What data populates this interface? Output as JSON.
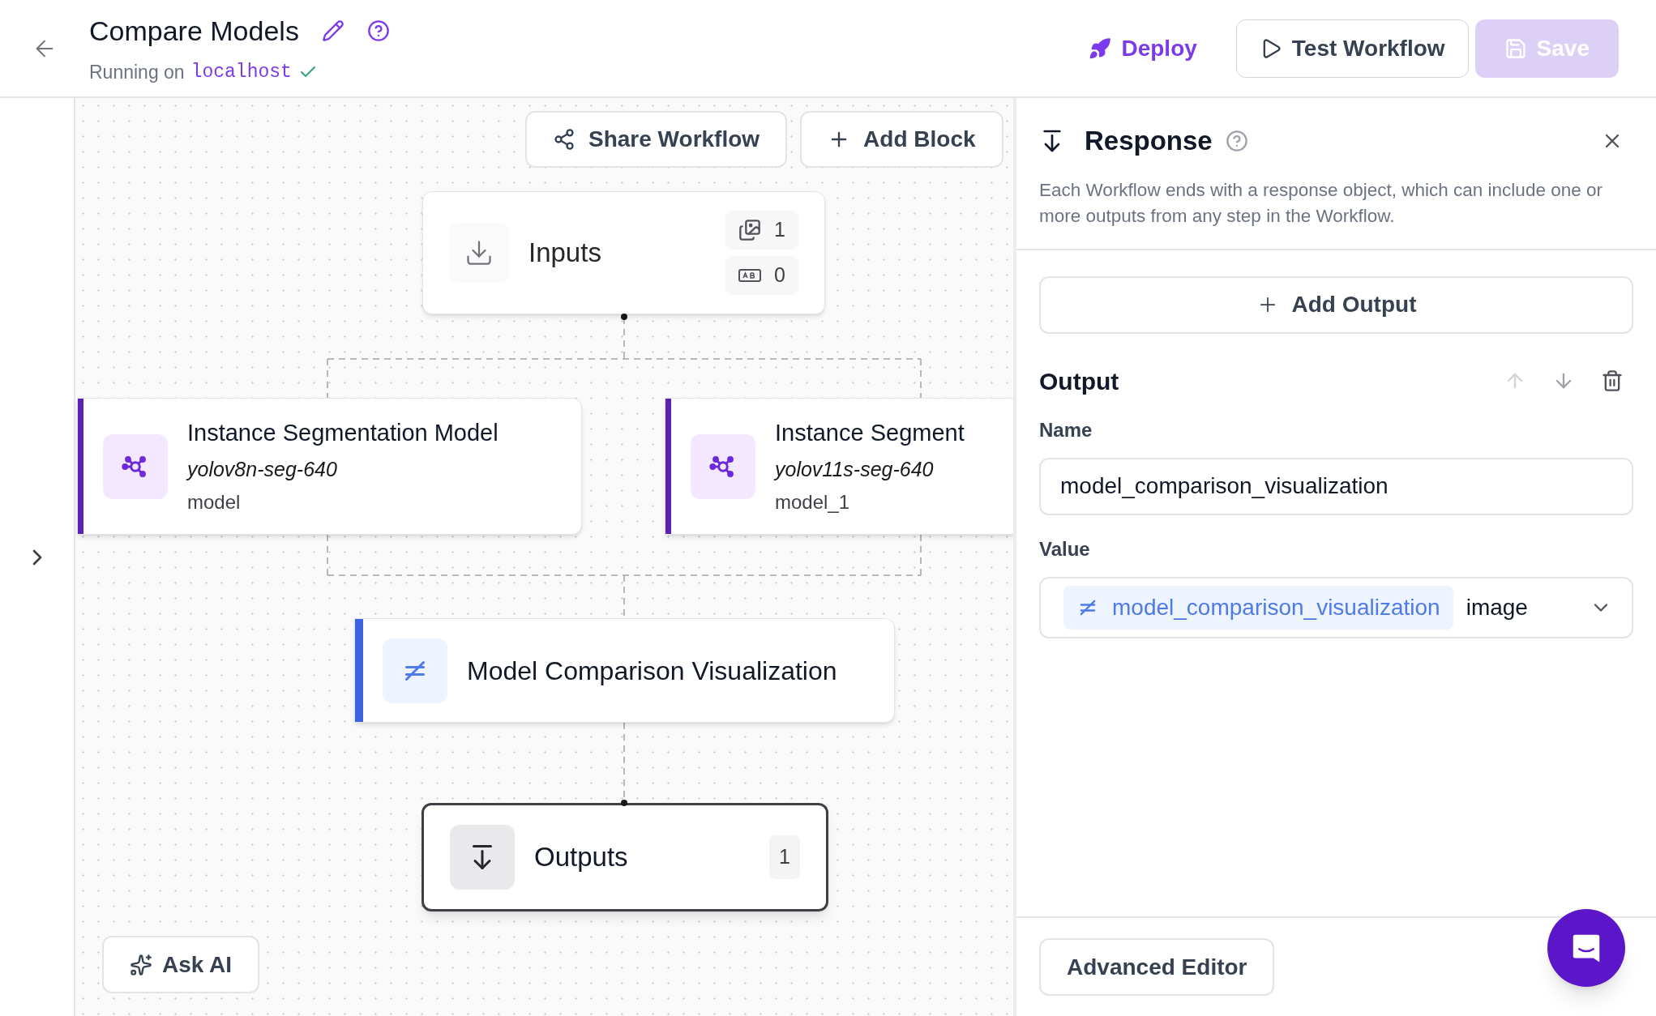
{
  "header": {
    "title": "Compare Models",
    "status_prefix": "Running on",
    "host": "localhost",
    "connected": true
  },
  "actions": [
    {
      "label": "Deploy",
      "kind": "link"
    },
    {
      "label": "Test Workflow",
      "kind": "outline"
    },
    {
      "label": "Save",
      "kind": "primary",
      "disabled": true
    }
  ],
  "canvas": {
    "toolbar": [
      {
        "label": "Share Workflow",
        "kind": "share"
      },
      {
        "label": "Add Block",
        "kind": "add"
      }
    ],
    "inputs": {
      "title": "Inputs",
      "counts": [
        {
          "kind": "image",
          "value": "1"
        },
        {
          "kind": "text",
          "value": "0"
        }
      ]
    },
    "nodes": [
      {
        "kind": "model",
        "title": "Instance Segmentation Model",
        "model_id": "yolov8n-seg-640",
        "name": "model"
      },
      {
        "kind": "model",
        "title": "Instance Segment",
        "model_id": "yolov11s-seg-640",
        "name": "model_1"
      },
      {
        "kind": "visualization",
        "title": "Model Comparison Visualization"
      }
    ],
    "outputs": {
      "title": "Outputs",
      "count": "1",
      "selected": true
    },
    "ask_ai": "Ask AI"
  },
  "panel": {
    "title": "Response",
    "description": "Each Workflow ends with a response object, which can include one or more outputs from any step in the Workflow.",
    "add_button": "Add Output",
    "output": {
      "heading": "Output",
      "name_label": "Name",
      "name_value": "model_comparison_visualization",
      "value_label": "Value",
      "value_chip": "model_comparison_visualization",
      "value_type": "image"
    },
    "footer_button": "Advanced Editor"
  }
}
